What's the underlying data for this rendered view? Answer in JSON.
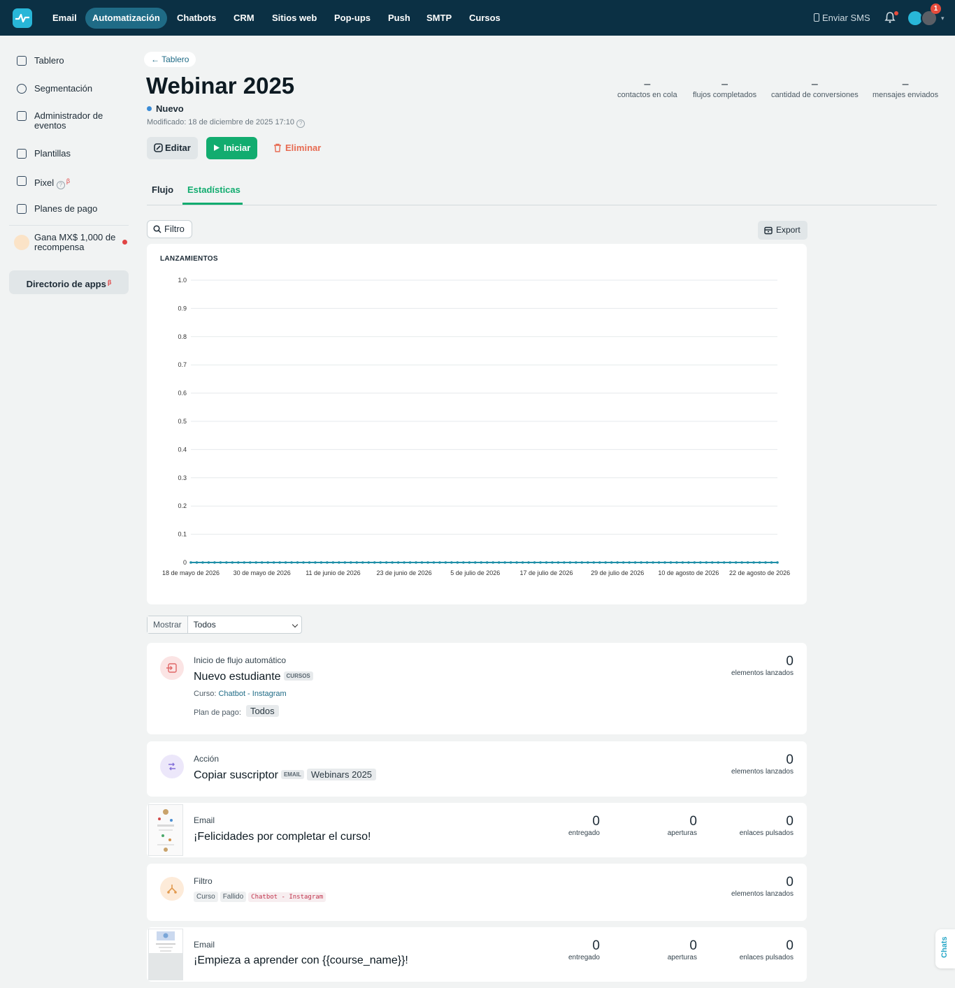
{
  "topnav": {
    "items": [
      "Email",
      "Automatización",
      "Chatbots",
      "CRM",
      "Sitios web",
      "Pop-ups",
      "Push",
      "SMTP",
      "Cursos"
    ],
    "send_sms": "Enviar SMS",
    "notification_count": "1"
  },
  "sidebar": {
    "items": [
      {
        "label": "Tablero",
        "icon": "dashboard-icon"
      },
      {
        "label": "Segmentación",
        "icon": "segment-icon"
      },
      {
        "label": "Administrador de eventos",
        "icon": "events-icon"
      },
      {
        "label": "Plantillas",
        "icon": "templates-icon"
      },
      {
        "label": "Pixel",
        "icon": "pixel-icon"
      },
      {
        "label": "Planes de pago",
        "icon": "payment-plans-icon"
      }
    ],
    "reward": "Gana MX$ 1,000 de recompensa",
    "app_directory": "Directorio de apps",
    "beta": "β"
  },
  "header": {
    "breadcrumb": "← Tablero",
    "title": "Webinar 2025",
    "status": "Nuevo",
    "modified": "Modificado: 18 de diciembre de 2025 17:10",
    "edit": "Editar",
    "start": "Iniciar",
    "delete": "Eliminar",
    "metrics": [
      {
        "value": "–",
        "label": "contactos en cola"
      },
      {
        "value": "–",
        "label": "flujos completados"
      },
      {
        "value": "–",
        "label": "cantidad de conversiones"
      },
      {
        "value": "–",
        "label": "mensajes enviados"
      }
    ]
  },
  "tabs": [
    {
      "label": "Flujo"
    },
    {
      "label": "Estadísticas"
    }
  ],
  "toolbar": {
    "filter": "Filtro",
    "export": "Export"
  },
  "chart_data": {
    "type": "line",
    "title": "LANZAMIENTOS",
    "xlabel": "",
    "ylabel": "",
    "ylim": [
      0,
      1.0
    ],
    "yticks": [
      "0",
      "0.1",
      "0.2",
      "0.3",
      "0.4",
      "0.5",
      "0.6",
      "0.7",
      "0.8",
      "0.9",
      "1.0"
    ],
    "x_tick_labels": [
      "18 de mayo de 2026",
      "30 de mayo de 2026",
      "11 de junio de 2026",
      "23 de junio de 2026",
      "5 de julio de 2026",
      "17 de julio de 2026",
      "29 de julio de 2026",
      "10 de agosto de 2026",
      "22 de agosto de 2026"
    ],
    "x_range": [
      "2026-05-18",
      "2026-08-25"
    ],
    "grid": true,
    "series": [
      {
        "values": "all zero",
        "color": "#1f8fa8"
      }
    ],
    "points_per_day": 1
  },
  "show": {
    "label": "Mostrar",
    "value": "Todos"
  },
  "steps": [
    {
      "kind": "Inicio de flujo automático",
      "title": "Nuevo estudiante",
      "tag": "CURSOS",
      "course_label": "Curso:",
      "course": "Chatbot - Instagram",
      "plan_label": "Plan de pago:",
      "plan": "Todos",
      "stat": {
        "value": "0",
        "label": "elementos lanzados"
      }
    },
    {
      "kind": "Acción",
      "title": "Copiar suscriptor",
      "tag": "EMAIL",
      "chip": "Webinars 2025",
      "stat": {
        "value": "0",
        "label": "elementos lanzados"
      }
    },
    {
      "kind": "Email",
      "title": "¡Felicidades por completar el curso!",
      "stats": [
        {
          "value": "0",
          "label": "entregado"
        },
        {
          "value": "0",
          "label": "aperturas"
        },
        {
          "value": "0",
          "label": "enlaces pulsados"
        }
      ]
    },
    {
      "kind": "Filtro",
      "tags": [
        "Curso",
        "Fallido",
        "Chatbot - Instagram"
      ],
      "stat": {
        "value": "0",
        "label": "elementos lanzados"
      }
    },
    {
      "kind": "Email",
      "title": "¡Empieza a aprender con {{course_name}}!",
      "stats": [
        {
          "value": "0",
          "label": "entregado"
        },
        {
          "value": "0",
          "label": "aperturas"
        },
        {
          "value": "0",
          "label": "enlaces pulsados"
        }
      ]
    }
  ],
  "chats": "Chats",
  "colors": {
    "accent": "#12ac6f",
    "nav": "#0b3044",
    "line": "#1f8fa8",
    "delete": "#e76b52"
  }
}
